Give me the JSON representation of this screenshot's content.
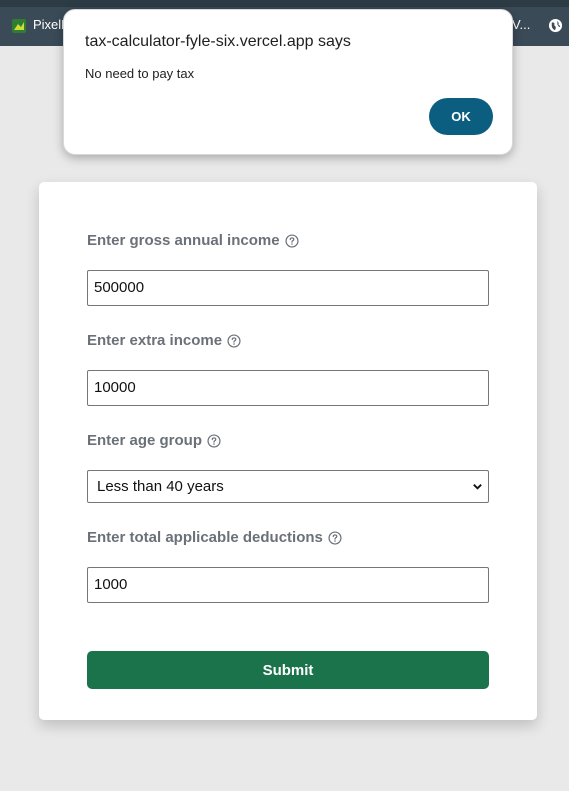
{
  "browser": {
    "tab_label": "PixelB",
    "tab_right_label": "V..."
  },
  "dialog": {
    "title": "tax-calculator-fyle-six.vercel.app says",
    "message": "No need to pay tax",
    "ok_label": "OK"
  },
  "form": {
    "gross_income": {
      "label": "Enter gross annual income",
      "value": "500000",
      "icon": "help-circle-icon"
    },
    "extra_income": {
      "label": "Enter extra income",
      "value": "10000",
      "icon": "help-circle-icon"
    },
    "age_group": {
      "label": "Enter age group",
      "selected": "Less than 40 years",
      "icon": "help-circle-icon"
    },
    "deductions": {
      "label": "Enter total applicable deductions",
      "value": "1000",
      "icon": "help-circle-icon"
    },
    "submit_label": "Submit"
  },
  "colors": {
    "ok_button": "#0c5e80",
    "submit_button": "#1a734a",
    "label_text": "#6b7178",
    "page_bg": "#e9e9e9"
  }
}
